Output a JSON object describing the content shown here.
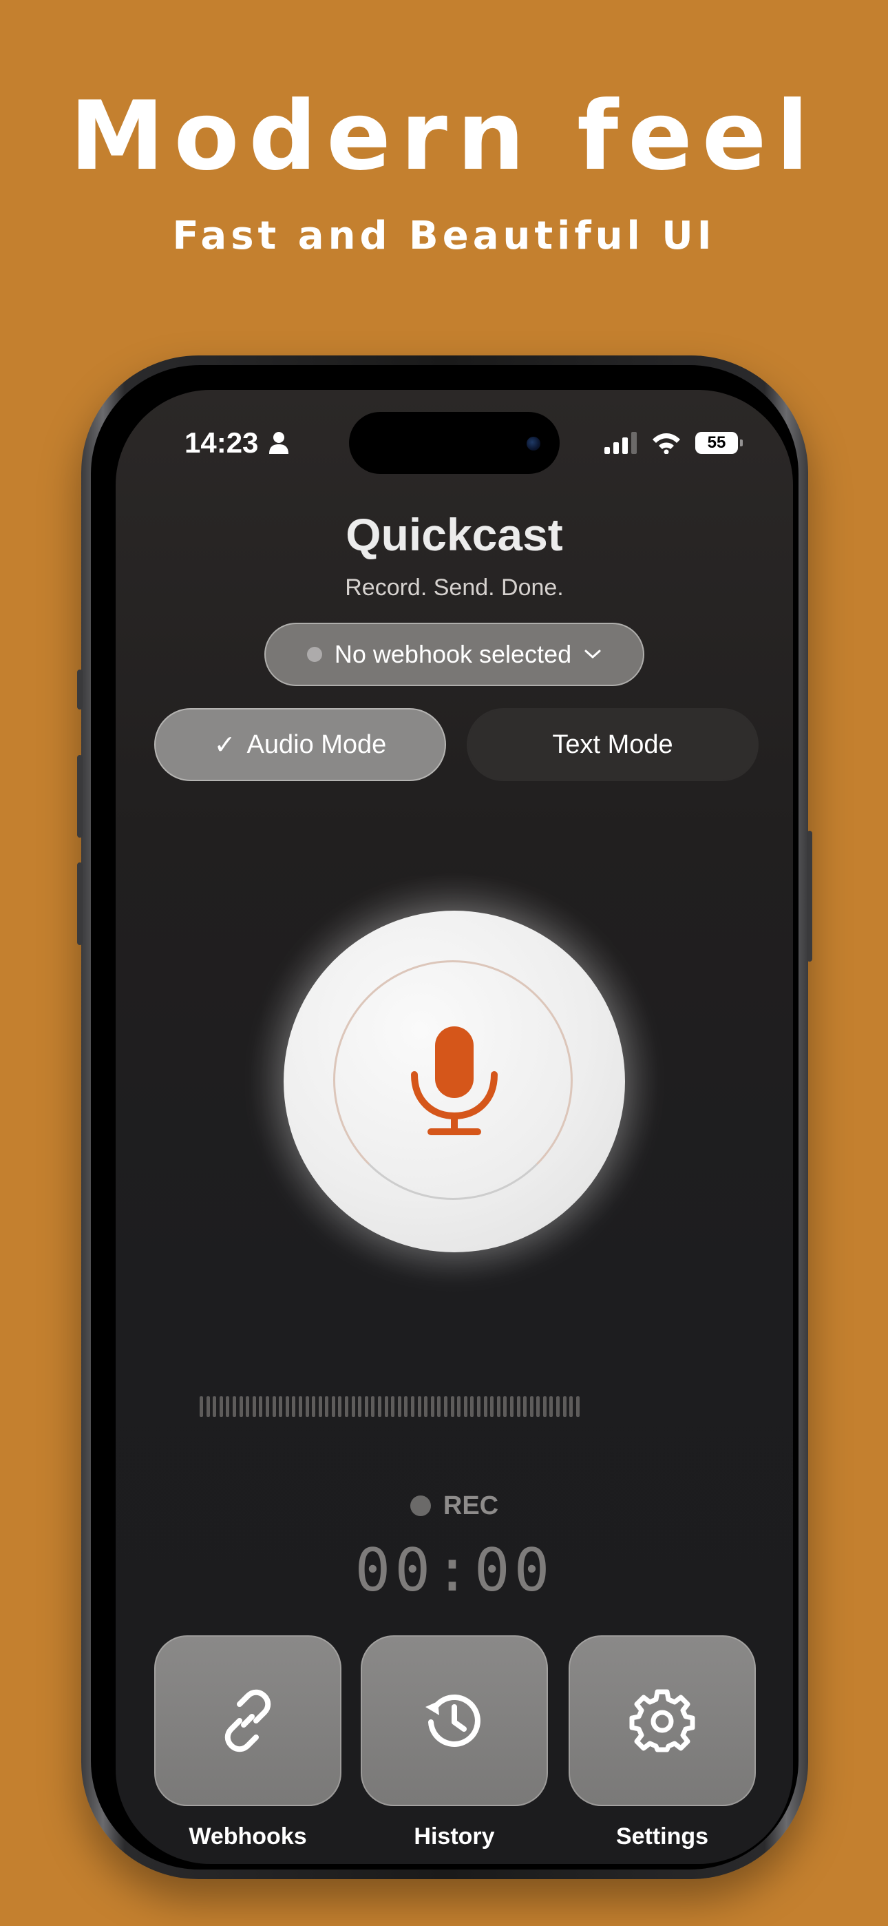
{
  "banner": {
    "headline": "Modern feel",
    "subheadline": "Fast and Beautiful UI",
    "background_color": "#c4802f"
  },
  "status_bar": {
    "time": "14:23",
    "battery": "55"
  },
  "app": {
    "title": "Quickcast",
    "tagline": "Record. Send. Done.",
    "accent_color": "#d5561a"
  },
  "webhook_selector": {
    "label": "No webhook selected"
  },
  "modes": {
    "audio": {
      "check": "✓",
      "label": "Audio Mode",
      "selected": true
    },
    "text": {
      "label": "Text Mode",
      "selected": false
    }
  },
  "recorder": {
    "status_label": "REC",
    "timer": "00:00",
    "waveform_bars": 58
  },
  "bottom_nav": {
    "webhooks": {
      "label": "Webhooks",
      "icon": "link-icon"
    },
    "history": {
      "label": "History",
      "icon": "history-icon"
    },
    "settings": {
      "label": "Settings",
      "icon": "gear-icon"
    }
  }
}
